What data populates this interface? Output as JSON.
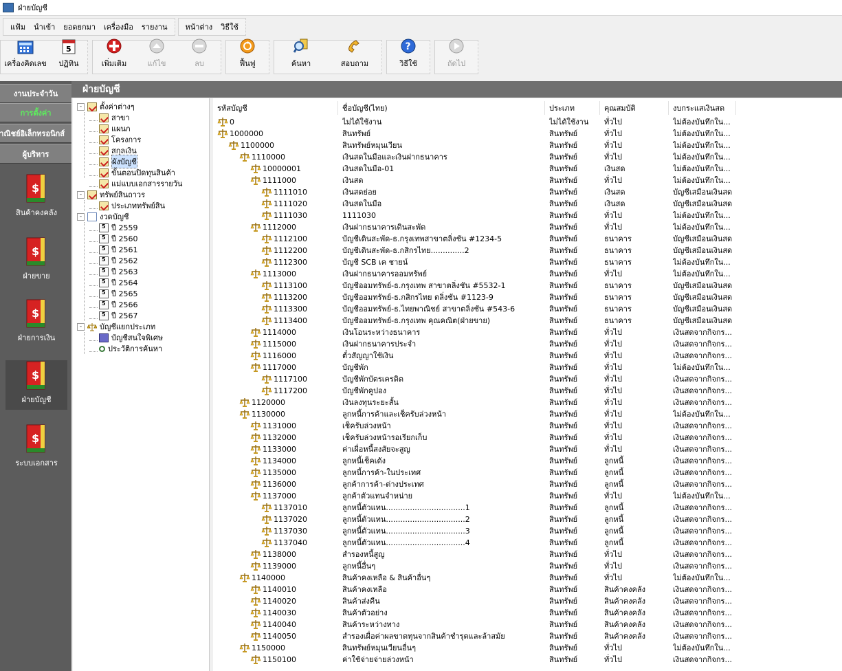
{
  "window": {
    "title": "ฝ่ายบัญชี"
  },
  "menu": {
    "group1": [
      "แฟ้ม",
      "นำเข้า",
      "ยอดยกมา",
      "เครื่องมือ",
      "รายงาน"
    ],
    "group2": [
      "หน้าต่าง",
      "วิธีใช้"
    ]
  },
  "toolbar": {
    "calculator": "เครื่องคิดเลข",
    "calendar": "ปฏิทิน",
    "add": "เพิ่มเติม",
    "edit": "แก้ไข",
    "delete": "ลบ",
    "restore": "ฟื้นฟู",
    "search": "ค้นหา",
    "inquire": "สอบถาม",
    "help": "วิธีใช้",
    "next": "ถัดไป"
  },
  "sidebar": {
    "buttons": [
      "งานประจำวัน",
      "การตั้งค่า",
      "พาณิชย์อิเล็กทรอนิกส์",
      "ผู้บริหาร"
    ],
    "modules": [
      "สินค้าคงคลัง",
      "ฝ่ายขาย",
      "ฝ่ายการเงิน",
      "ฝ่ายบัญชี",
      "ระบบเอกสาร"
    ]
  },
  "panel_title": "ฝ่ายบัญชี",
  "tree": [
    {
      "label": "ตั้งค่าต่างๆ",
      "icon": "folder",
      "level": 0,
      "toggle": "-"
    },
    {
      "label": "สาขา",
      "icon": "folder",
      "level": 1
    },
    {
      "label": "แผนก",
      "icon": "folder",
      "level": 1
    },
    {
      "label": "โครงการ",
      "icon": "folder",
      "level": 1
    },
    {
      "label": "สกุลเงิน",
      "icon": "folder",
      "level": 1
    },
    {
      "label": "ผังบัญชี",
      "icon": "folder",
      "level": 1,
      "selected": true
    },
    {
      "label": "ขั้นตอนปิดทุนสินค้า",
      "icon": "folder",
      "level": 1
    },
    {
      "label": "แม่แบบเอกสารรายวัน",
      "icon": "folder",
      "level": 1
    },
    {
      "label": "ทรัพย์สินถาวร",
      "icon": "folder",
      "level": 0,
      "toggle": "-"
    },
    {
      "label": "ประเภททรัพย์สิน",
      "icon": "folder",
      "level": 1
    },
    {
      "label": "งวดบัญชี",
      "icon": "doc",
      "level": 0,
      "toggle": "-"
    },
    {
      "label": "ปี 2559",
      "icon": "cal",
      "level": 1
    },
    {
      "label": "ปี 2560",
      "icon": "cal",
      "level": 1
    },
    {
      "label": "ปี 2561",
      "icon": "cal",
      "level": 1
    },
    {
      "label": "ปี 2562",
      "icon": "cal",
      "level": 1
    },
    {
      "label": "ปี 2563",
      "icon": "cal",
      "level": 1
    },
    {
      "label": "ปี 2564",
      "icon": "cal",
      "level": 1
    },
    {
      "label": "ปี 2565",
      "icon": "cal",
      "level": 1
    },
    {
      "label": "ปี 2566",
      "icon": "cal",
      "level": 1
    },
    {
      "label": "ปี 2567",
      "icon": "cal",
      "level": 1
    },
    {
      "label": "บัญชีแยกประเภท",
      "icon": "scale",
      "level": 0,
      "toggle": "-"
    },
    {
      "label": "บัญชีสนใจพิเศษ",
      "icon": "book2",
      "level": 1
    },
    {
      "label": "ประวัติการค้นหา",
      "icon": "search",
      "level": 1
    }
  ],
  "columns": [
    "รหัสบัญชี",
    "ชื่อบัญชี(ไทย)",
    "ประเภท",
    "คุณสมบัติ",
    "งบกระแสเงินสด"
  ],
  "accounts": [
    {
      "code": "0",
      "level": 0,
      "name": "ไม่ได้ใช้งาน",
      "type": "ไม่ได้ใช้งาน",
      "attr": "ทั่วไป",
      "cash": "ไม่ต้องบันทึกใน..."
    },
    {
      "code": "1000000",
      "level": 0,
      "name": "สินทรัพย์",
      "type": "สินทรัพย์",
      "attr": "ทั่วไป",
      "cash": "ไม่ต้องบันทึกใน..."
    },
    {
      "code": "1100000",
      "level": 1,
      "name": "สินทรัพย์หมุนเวียน",
      "type": "สินทรัพย์",
      "attr": "ทั่วไป",
      "cash": "ไม่ต้องบันทึกใน..."
    },
    {
      "code": "1110000",
      "level": 2,
      "name": "เงินสดในมือและเงินฝากธนาคาร",
      "type": "สินทรัพย์",
      "attr": "ทั่วไป",
      "cash": "ไม่ต้องบันทึกใน..."
    },
    {
      "code": "10000001",
      "level": 3,
      "name": "เงินสดในมือ-01",
      "type": "สินทรัพย์",
      "attr": "เงินสด",
      "cash": "ไม่ต้องบันทึกใน..."
    },
    {
      "code": "1111000",
      "level": 3,
      "name": "เงินสด",
      "type": "สินทรัพย์",
      "attr": "ทั่วไป",
      "cash": "ไม่ต้องบันทึกใน..."
    },
    {
      "code": "1111010",
      "level": 4,
      "name": "เงินสดย่อย",
      "type": "สินทรัพย์",
      "attr": "เงินสด",
      "cash": "บัญชีเสมือนเงินสด"
    },
    {
      "code": "1111020",
      "level": 4,
      "name": "เงินสดในมือ",
      "type": "สินทรัพย์",
      "attr": "เงินสด",
      "cash": "บัญชีเสมือนเงินสด"
    },
    {
      "code": "1111030",
      "level": 4,
      "name": "1111030",
      "type": "สินทรัพย์",
      "attr": "ทั่วไป",
      "cash": "ไม่ต้องบันทึกใน..."
    },
    {
      "code": "1112000",
      "level": 3,
      "name": "เงินฝากธนาคารเดินสะพัด",
      "type": "สินทรัพย์",
      "attr": "ทั่วไป",
      "cash": "ไม่ต้องบันทึกใน..."
    },
    {
      "code": "1112100",
      "level": 4,
      "name": "บัญชีเดินสะพัด-ธ.กรุงเทพสาขาตลิ่งชัน #1234-5",
      "type": "สินทรัพย์",
      "attr": "ธนาคาร",
      "cash": "บัญชีเสมือนเงินสด"
    },
    {
      "code": "1112200",
      "level": 4,
      "name": "บัญชีเดินสะพัด-ธ.กสิกรไทย..............2",
      "type": "สินทรัพย์",
      "attr": "ธนาคาร",
      "cash": "บัญชีเสมือนเงินสด"
    },
    {
      "code": "1112300",
      "level": 4,
      "name": "บัญชี SCB เค ชายน์",
      "type": "สินทรัพย์",
      "attr": "ธนาคาร",
      "cash": "ไม่ต้องบันทึกใน..."
    },
    {
      "code": "1113000",
      "level": 3,
      "name": "เงินฝากธนาคารออมทรัพย์",
      "type": "สินทรัพย์",
      "attr": "ทั่วไป",
      "cash": "ไม่ต้องบันทึกใน..."
    },
    {
      "code": "1113100",
      "level": 4,
      "name": "บัญชีออมทรัพย์-ธ.กรุงเทพ สาขาตลิ่งชัน #5532-1",
      "type": "สินทรัพย์",
      "attr": "ธนาคาร",
      "cash": "บัญชีเสมือนเงินสด"
    },
    {
      "code": "1113200",
      "level": 4,
      "name": "บัญชีออมทรัพย์-ธ.กสิกรไทย ตลิ่งชัน #1123-9",
      "type": "สินทรัพย์",
      "attr": "ธนาคาร",
      "cash": "บัญชีเสมือนเงินสด"
    },
    {
      "code": "1113300",
      "level": 4,
      "name": "บัญชีออมทรัพย์-ธ.ไทยพาณิชย์ สาขาตลิ่งชัน #543-6",
      "type": "สินทรัพย์",
      "attr": "ธนาคาร",
      "cash": "บัญชีเสมือนเงินสด"
    },
    {
      "code": "1113400",
      "level": 4,
      "name": "บัญชีออมทรัพย์-ธ.กรุงเทพ คุณคณิต(ฝ่ายขาย)",
      "type": "สินทรัพย์",
      "attr": "ธนาคาร",
      "cash": "บัญชีเสมือนเงินสด"
    },
    {
      "code": "1114000",
      "level": 3,
      "name": "เงินโอนระหว่างธนาคาร",
      "type": "สินทรัพย์",
      "attr": "ทั่วไป",
      "cash": "เงินสดจากกิจกร..."
    },
    {
      "code": "1115000",
      "level": 3,
      "name": "เงินฝากธนาคารประจำ",
      "type": "สินทรัพย์",
      "attr": "ทั่วไป",
      "cash": "เงินสดจากกิจกร..."
    },
    {
      "code": "1116000",
      "level": 3,
      "name": "ตั๋วสัญญาใช้เงิน",
      "type": "สินทรัพย์",
      "attr": "ทั่วไป",
      "cash": "เงินสดจากกิจกร..."
    },
    {
      "code": "1117000",
      "level": 3,
      "name": "บัญชีพัก",
      "type": "สินทรัพย์",
      "attr": "ทั่วไป",
      "cash": "ไม่ต้องบันทึกใน..."
    },
    {
      "code": "1117100",
      "level": 4,
      "name": "บัญชีพักบัตรเครดิต",
      "type": "สินทรัพย์",
      "attr": "ทั่วไป",
      "cash": "เงินสดจากกิจกร..."
    },
    {
      "code": "1117200",
      "level": 4,
      "name": "บัญชีพักคูปอง",
      "type": "สินทรัพย์",
      "attr": "ทั่วไป",
      "cash": "เงินสดจากกิจกร..."
    },
    {
      "code": "1120000",
      "level": 2,
      "name": "เงินลงทุนระยะสั้น",
      "type": "สินทรัพย์",
      "attr": "ทั่วไป",
      "cash": "เงินสดจากกิจกร..."
    },
    {
      "code": "1130000",
      "level": 2,
      "name": "ลูกหนี้การค้าและเช็ครับล่วงหน้า",
      "type": "สินทรัพย์",
      "attr": "ทั่วไป",
      "cash": "ไม่ต้องบันทึกใน..."
    },
    {
      "code": "1131000",
      "level": 3,
      "name": "เช็ครับล่วงหน้า",
      "type": "สินทรัพย์",
      "attr": "ทั่วไป",
      "cash": "เงินสดจากกิจกร..."
    },
    {
      "code": "1132000",
      "level": 3,
      "name": "เช็ครับล่วงหน้ารอเรียกเก็บ",
      "type": "สินทรัพย์",
      "attr": "ทั่วไป",
      "cash": "เงินสดจากกิจกร..."
    },
    {
      "code": "1133000",
      "level": 3,
      "name": "ค่าเผื่อหนี้สงสัยจะสูญ",
      "type": "สินทรัพย์",
      "attr": "ทั่วไป",
      "cash": "เงินสดจากกิจกร..."
    },
    {
      "code": "1134000",
      "level": 3,
      "name": "ลูกหนี้เช็คเด้ง",
      "type": "สินทรัพย์",
      "attr": "ลูกหนี้",
      "cash": "เงินสดจากกิจกร..."
    },
    {
      "code": "1135000",
      "level": 3,
      "name": "ลูกหนี้การค้า-ในประเทศ",
      "type": "สินทรัพย์",
      "attr": "ลูกหนี้",
      "cash": "เงินสดจากกิจกร..."
    },
    {
      "code": "1136000",
      "level": 3,
      "name": "ลูกค้าการค้า-ต่างประเทศ",
      "type": "สินทรัพย์",
      "attr": "ลูกหนี้",
      "cash": "เงินสดจากกิจกร..."
    },
    {
      "code": "1137000",
      "level": 3,
      "name": "ลูกค้าตัวแทนจำหน่าย",
      "type": "สินทรัพย์",
      "attr": "ทั่วไป",
      "cash": "ไม่ต้องบันทึกใน..."
    },
    {
      "code": "1137010",
      "level": 4,
      "name": "ลูกหนี้ตัวแทน.................................1",
      "type": "สินทรัพย์",
      "attr": "ลูกหนี้",
      "cash": "เงินสดจากกิจกร..."
    },
    {
      "code": "1137020",
      "level": 4,
      "name": "ลูกหนี้ตัวแทน.................................2",
      "type": "สินทรัพย์",
      "attr": "ลูกหนี้",
      "cash": "เงินสดจากกิจกร..."
    },
    {
      "code": "1137030",
      "level": 4,
      "name": "ลูกหนี้ตัวแทน.................................3",
      "type": "สินทรัพย์",
      "attr": "ลูกหนี้",
      "cash": "เงินสดจากกิจกร..."
    },
    {
      "code": "1137040",
      "level": 4,
      "name": "ลูกหนี้ตัวแทน.................................4",
      "type": "สินทรัพย์",
      "attr": "ลูกหนี้",
      "cash": "เงินสดจากกิจกร..."
    },
    {
      "code": "1138000",
      "level": 3,
      "name": "สำรองหนี้สูญ",
      "type": "สินทรัพย์",
      "attr": "ทั่วไป",
      "cash": "เงินสดจากกิจกร..."
    },
    {
      "code": "1139000",
      "level": 3,
      "name": "ลูกหนี้อื่นๆ",
      "type": "สินทรัพย์",
      "attr": "ทั่วไป",
      "cash": "เงินสดจากกิจกร..."
    },
    {
      "code": "1140000",
      "level": 2,
      "name": "สินค้าคงเหลือ & สินค้าอื่นๆ",
      "type": "สินทรัพย์",
      "attr": "ทั่วไป",
      "cash": "ไม่ต้องบันทึกใน..."
    },
    {
      "code": "1140010",
      "level": 3,
      "name": "สินค้าคงเหลือ",
      "type": "สินทรัพย์",
      "attr": "สินค้าคงคลัง",
      "cash": "เงินสดจากกิจกร..."
    },
    {
      "code": "1140020",
      "level": 3,
      "name": "สินค้าส่งคืน",
      "type": "สินทรัพย์",
      "attr": "สินค้าคงคลัง",
      "cash": "เงินสดจากกิจกร..."
    },
    {
      "code": "1140030",
      "level": 3,
      "name": "สินค้าตัวอย่าง",
      "type": "สินทรัพย์",
      "attr": "สินค้าคงคลัง",
      "cash": "เงินสดจากกิจกร..."
    },
    {
      "code": "1140040",
      "level": 3,
      "name": "สินค้าระหว่างทาง",
      "type": "สินทรัพย์",
      "attr": "สินค้าคงคลัง",
      "cash": "เงินสดจากกิจกร..."
    },
    {
      "code": "1140050",
      "level": 3,
      "name": "สำรองเผื่อค่าผลขาดทุนจากสินค้าชำรุดและล้าสมัย",
      "type": "สินทรัพย์",
      "attr": "สินค้าคงคลัง",
      "cash": "เงินสดจากกิจกร..."
    },
    {
      "code": "1150000",
      "level": 2,
      "name": "สินทรัพย์หมุนเวียนอื่นๆ",
      "type": "สินทรัพย์",
      "attr": "ทั่วไป",
      "cash": "ไม่ต้องบันทึกใน..."
    },
    {
      "code": "1150100",
      "level": 3,
      "name": "ค่าใช้จ่ายจ่ายล่วงหน้า",
      "type": "สินทรัพย์",
      "attr": "ทั่วไป",
      "cash": "เงินสดจากกิจกร..."
    }
  ]
}
